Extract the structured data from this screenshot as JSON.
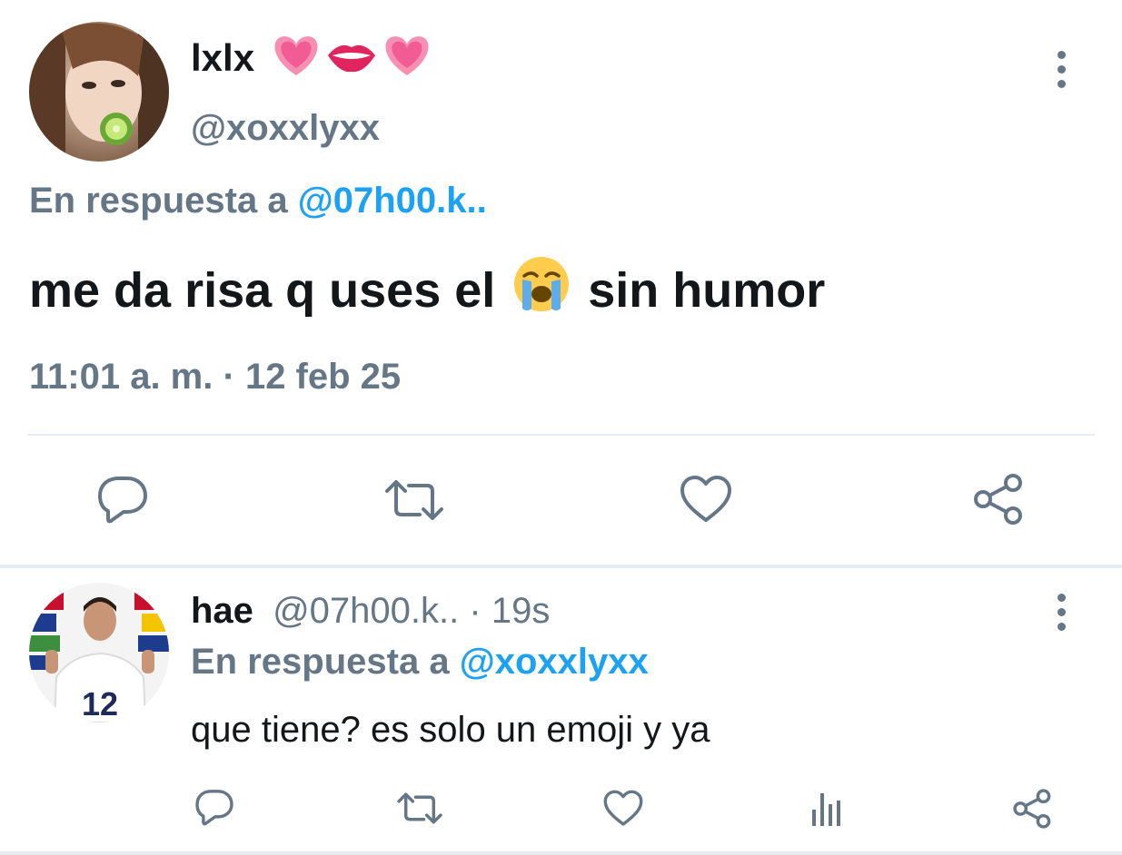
{
  "main_tweet": {
    "display_name": "lxlx",
    "handle": "@xoxxlyxx",
    "reply_prefix": "En respuesta a",
    "reply_to": "@07h00.k..",
    "text_before_emoji": "me da risa q uses el",
    "text_after_emoji": "sin humor",
    "time": "11:01 a. m.",
    "separator": "·",
    "date": "12 feb 25"
  },
  "reply_tweet": {
    "display_name": "hae",
    "handle": "@07h00.k..",
    "separator": "·",
    "age": "19s",
    "reply_prefix": "En respuesta a",
    "reply_to": "@xoxxlyxx",
    "text": "que tiene? es solo un emoji y ya",
    "jersey_number": "12"
  },
  "colors": {
    "accent": "#1da1f2",
    "secondary_text": "#657786",
    "primary_text": "#14171a",
    "divider": "#e6ecf0"
  },
  "icons": {
    "name_emojis": [
      "pink-heart-icon",
      "lips-icon",
      "pink-heart-icon"
    ],
    "main_actions": [
      "reply-icon",
      "retweet-icon",
      "like-icon",
      "share-icon"
    ],
    "reply_actions": [
      "reply-icon",
      "retweet-icon",
      "like-icon",
      "analytics-icon",
      "share-icon"
    ]
  }
}
